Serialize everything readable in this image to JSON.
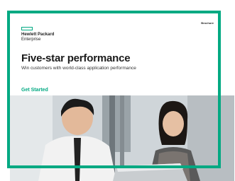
{
  "brochure_label": "Brochure",
  "logo": {
    "line1": "Hewlett Packard",
    "line2": "Enterprise"
  },
  "headline": "Five-star performance",
  "subhead": "Win customers with world-class application performance",
  "cta": "Get Started",
  "colors": {
    "accent": "#01a982"
  },
  "photo": {
    "subject": "two-people-working-at-laptop"
  }
}
